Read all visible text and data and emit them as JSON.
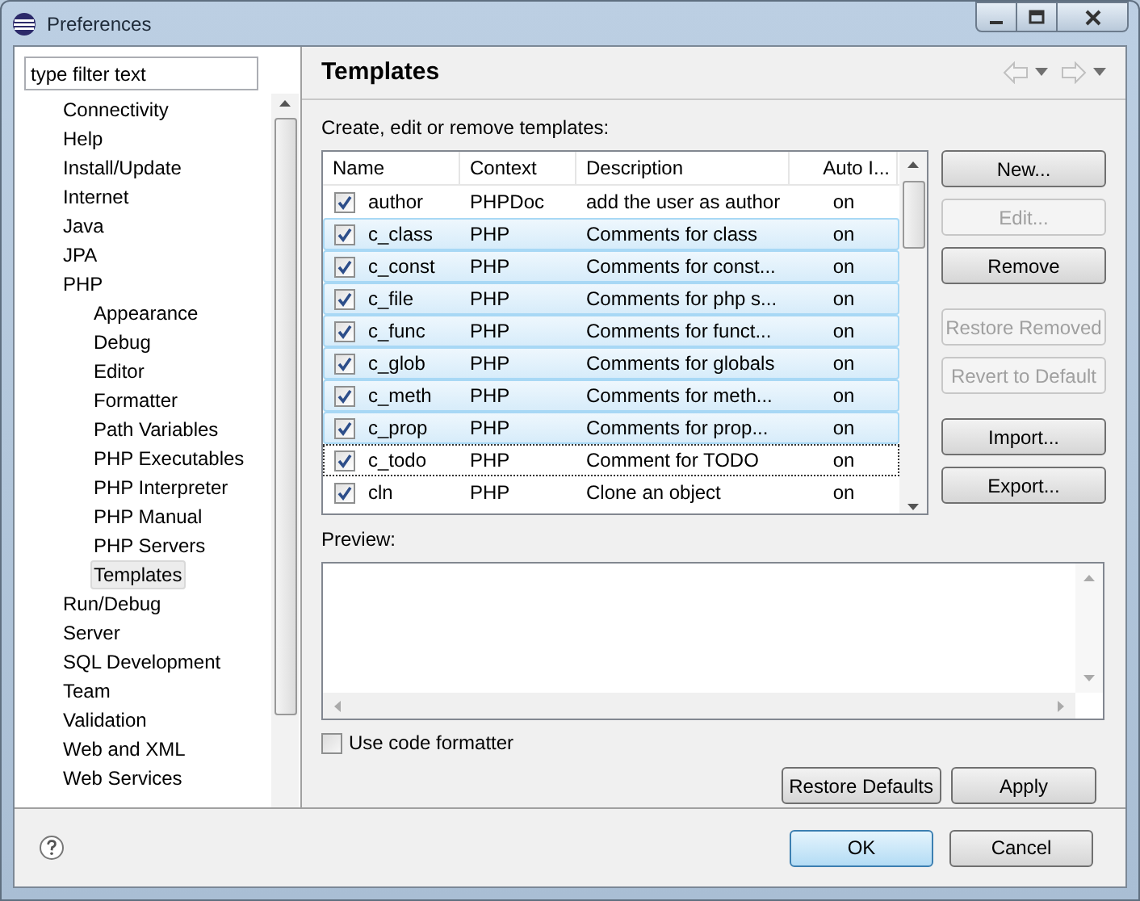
{
  "window": {
    "title": "Preferences"
  },
  "filter": {
    "placeholder": "type filter text"
  },
  "tree": [
    {
      "label": "Connectivity",
      "selected": false
    },
    {
      "label": "Help",
      "selected": false
    },
    {
      "label": "Install/Update",
      "selected": false
    },
    {
      "label": "Internet",
      "selected": false
    },
    {
      "label": "Java",
      "selected": false
    },
    {
      "label": "JPA",
      "selected": false
    },
    {
      "label": "PHP",
      "selected": false,
      "children": [
        {
          "label": "Appearance",
          "selected": false
        },
        {
          "label": "Debug",
          "selected": false
        },
        {
          "label": "Editor",
          "selected": false
        },
        {
          "label": "Formatter",
          "selected": false
        },
        {
          "label": "Path Variables",
          "selected": false
        },
        {
          "label": "PHP Executables",
          "selected": false
        },
        {
          "label": "PHP Interpreter",
          "selected": false
        },
        {
          "label": "PHP Manual",
          "selected": false
        },
        {
          "label": "PHP Servers",
          "selected": false
        },
        {
          "label": "Templates",
          "selected": true
        }
      ]
    },
    {
      "label": "Run/Debug",
      "selected": false
    },
    {
      "label": "Server",
      "selected": false
    },
    {
      "label": "SQL Development",
      "selected": false
    },
    {
      "label": "Team",
      "selected": false
    },
    {
      "label": "Validation",
      "selected": false
    },
    {
      "label": "Web and XML",
      "selected": false
    },
    {
      "label": "Web Services",
      "selected": false
    }
  ],
  "page": {
    "title": "Templates",
    "intro": "Create, edit or remove templates:"
  },
  "table": {
    "columns": [
      "Name",
      "Context",
      "Description",
      "Auto I..."
    ],
    "rows": [
      {
        "checked": true,
        "selected": false,
        "focused": false,
        "cells": [
          "author",
          "PHPDoc",
          "add the user as author",
          "on"
        ]
      },
      {
        "checked": true,
        "selected": true,
        "focused": false,
        "cells": [
          "c_class",
          "PHP",
          "Comments for class",
          "on"
        ]
      },
      {
        "checked": true,
        "selected": true,
        "focused": false,
        "cells": [
          "c_const",
          "PHP",
          "Comments for const...",
          "on"
        ]
      },
      {
        "checked": true,
        "selected": true,
        "focused": false,
        "cells": [
          "c_file",
          "PHP",
          "Comments for php s...",
          "on"
        ]
      },
      {
        "checked": true,
        "selected": true,
        "focused": false,
        "cells": [
          "c_func",
          "PHP",
          "Comments for funct...",
          "on"
        ]
      },
      {
        "checked": true,
        "selected": true,
        "focused": false,
        "cells": [
          "c_glob",
          "PHP",
          "Comments for globals",
          "on"
        ]
      },
      {
        "checked": true,
        "selected": true,
        "focused": false,
        "cells": [
          "c_meth",
          "PHP",
          "Comments for meth...",
          "on"
        ]
      },
      {
        "checked": true,
        "selected": true,
        "focused": false,
        "cells": [
          "c_prop",
          "PHP",
          "Comments for prop...",
          "on"
        ]
      },
      {
        "checked": true,
        "selected": false,
        "focused": true,
        "cells": [
          "c_todo",
          "PHP",
          "Comment for TODO",
          "on"
        ]
      },
      {
        "checked": true,
        "selected": false,
        "focused": false,
        "cells": [
          "cln",
          "PHP",
          "Clone an object",
          "on"
        ]
      }
    ]
  },
  "side_buttons": [
    {
      "label": "New...",
      "disabled": false
    },
    {
      "label": "Edit...",
      "disabled": true
    },
    {
      "label": "Remove",
      "disabled": false
    },
    {
      "label": "Restore Removed",
      "disabled": true
    },
    {
      "label": "Revert to Default",
      "disabled": true
    },
    {
      "label": "Import...",
      "disabled": false
    },
    {
      "label": "Export...",
      "disabled": false
    }
  ],
  "preview": {
    "label": "Preview:"
  },
  "formatter": {
    "label": "Use code formatter",
    "checked": false
  },
  "page_buttons": [
    "Restore Defaults",
    "Apply"
  ],
  "dialog_buttons": [
    {
      "label": "OK",
      "default": true
    },
    {
      "label": "Cancel",
      "default": false
    }
  ]
}
